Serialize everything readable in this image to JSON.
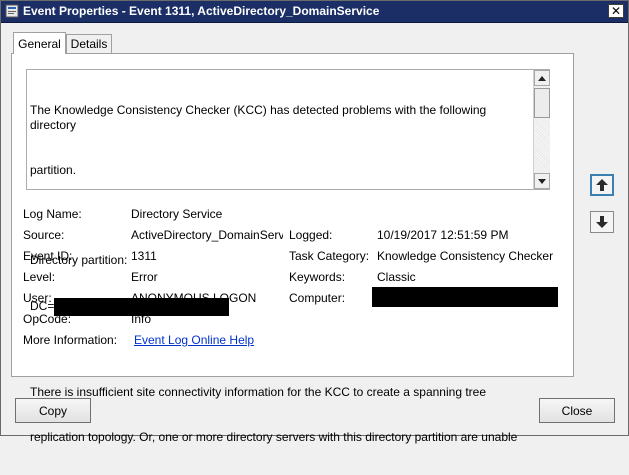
{
  "window": {
    "title": "Event Properties - Event 1311, ActiveDirectory_DomainService",
    "close_glyph": "✕"
  },
  "tabs": [
    {
      "label": "General",
      "selected": true
    },
    {
      "label": "Details",
      "selected": false
    }
  ],
  "description": {
    "line1": "The Knowledge Consistency Checker (KCC) has detected problems with the following directory",
    "line2": "partition.",
    "line3": "Directory partition:",
    "line4_prefix": "DC=",
    "line5": "There is insufficient site connectivity information for the KCC to create a spanning tree",
    "line6": "replication topology. Or, one or more directory servers with this directory partition are unable"
  },
  "fields": {
    "log_name": {
      "label": "Log Name:",
      "value": "Directory Service"
    },
    "source": {
      "label": "Source:",
      "value": "ActiveDirectory_DomainServ"
    },
    "logged": {
      "label": "Logged:",
      "value": "10/19/2017 12:51:59 PM"
    },
    "event_id": {
      "label": "Event ID:",
      "value": "1311"
    },
    "task_category": {
      "label": "Task Category:",
      "value": "Knowledge Consistency Checker"
    },
    "level": {
      "label": "Level:",
      "value": "Error"
    },
    "keywords": {
      "label": "Keywords:",
      "value": "Classic"
    },
    "user": {
      "label": "User:",
      "value": "ANONYMOUS LOGON"
    },
    "computer": {
      "label": "Computer:",
      "value": ""
    },
    "opcode": {
      "label": "OpCode:",
      "value": "Info"
    },
    "more_info": {
      "label": "More Information:",
      "link": "Event Log Online Help"
    }
  },
  "buttons": {
    "copy": "Copy",
    "close": "Close"
  },
  "icons": {
    "title": "event-log-icon",
    "nav_up": "arrow-up-icon",
    "nav_down": "arrow-down-icon"
  }
}
